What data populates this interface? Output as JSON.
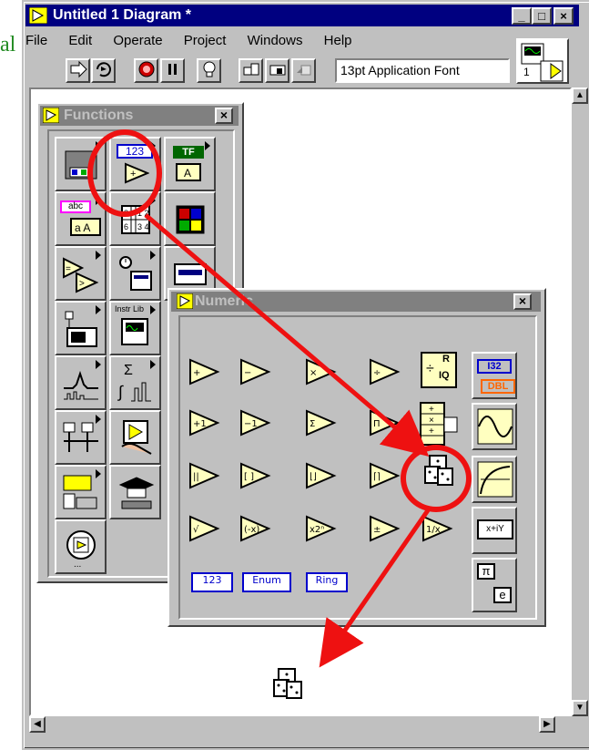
{
  "window": {
    "title": "Untitled 1 Diagram *",
    "min_label": "_",
    "max_label": "□",
    "close_label": "×"
  },
  "menu": {
    "items": [
      "File",
      "Edit",
      "Operate",
      "Project",
      "Windows",
      "Help"
    ]
  },
  "toolbar": {
    "font_select": "13pt Application Font",
    "connector_number": "1"
  },
  "left_fragment": "al",
  "functions_palette": {
    "title": "Functions",
    "close_label": "×",
    "numeric_label": "123",
    "boolean_label": "TF",
    "string_label": "abc",
    "instr_label": "Instr Lib",
    "sigma_label": "Σ"
  },
  "numeric_palette": {
    "title": "Numeric",
    "close_label": "×",
    "constants": [
      "123",
      "Enum",
      "Ring"
    ],
    "conversion_labels": [
      "I32",
      "DBL"
    ],
    "complex_label": "x+iY",
    "math_constants": [
      "π",
      "e"
    ],
    "quotient_labels": [
      "R",
      "IQ"
    ]
  },
  "colors": {
    "titlebar_active": "#000080",
    "titlebar_inactive": "#808080",
    "highlight_circle": "#ee1111",
    "highlight_arrow": "#ee1111",
    "function_fill": "#ffffc0",
    "constant_blue": "#0000cc"
  }
}
